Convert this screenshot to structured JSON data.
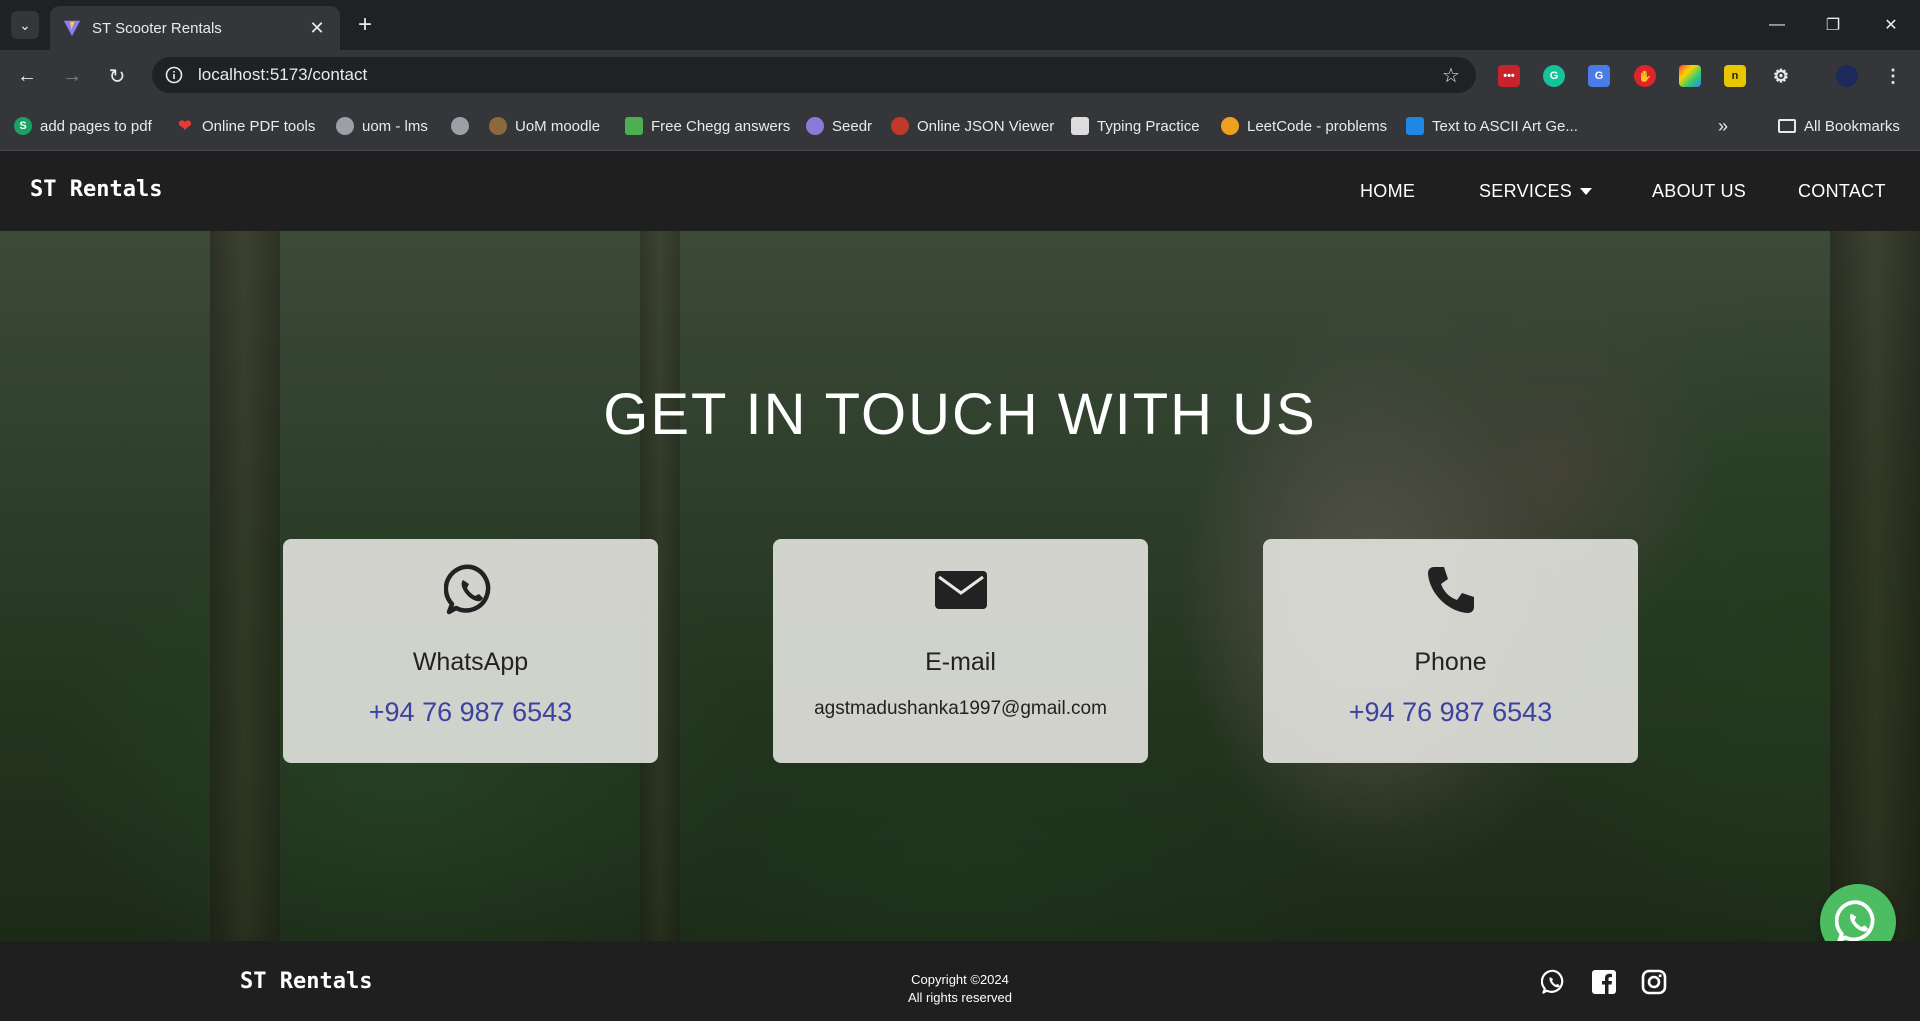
{
  "browser": {
    "tab_title": "ST Scooter Rentals",
    "url": "localhost:5173/contact",
    "bookmarks": [
      {
        "label": "add pages to pdf",
        "icon": "s-green-icon"
      },
      {
        "label": "Online PDF tools",
        "icon": "heart-icon"
      },
      {
        "label": "uom - lms",
        "icon": "globe-icon"
      },
      {
        "label": "",
        "icon": "globe-icon"
      },
      {
        "label": "UoM moodle",
        "icon": "moodle-icon"
      },
      {
        "label": "Free Chegg answers",
        "icon": "books-icon"
      },
      {
        "label": "Seedr",
        "icon": "seedr-icon"
      },
      {
        "label": "Online JSON Viewer",
        "icon": "json-icon"
      },
      {
        "label": "Typing Practice",
        "icon": "keyboard-icon"
      },
      {
        "label": "LeetCode - problems",
        "icon": "leetcode-icon"
      },
      {
        "label": "Text to ASCII Art Ge...",
        "icon": "react-icon"
      }
    ],
    "all_bookmarks_label": "All Bookmarks"
  },
  "site": {
    "brand": "ST Rentals",
    "nav": {
      "home": "HOME",
      "services": "SERVICES",
      "about": "ABOUT US",
      "contact": "CONTACT"
    }
  },
  "hero": {
    "title": "GET IN TOUCH WITH US"
  },
  "cards": {
    "whatsapp": {
      "title": "WhatsApp",
      "value": "+94 76 987 6543"
    },
    "email": {
      "title": "E-mail",
      "value": "agstmadushanka1997@gmail.com"
    },
    "phone": {
      "title": "Phone",
      "value": "+94 76 987 6543"
    }
  },
  "footer": {
    "brand": "ST Rentals",
    "copyright_line1": "Copyright ©2024",
    "copyright_line2": "All rights reserved"
  },
  "colors": {
    "header_bg": "#1f1f1f",
    "link_blue": "#3b42a0",
    "whatsapp_green": "#4cbd63"
  }
}
